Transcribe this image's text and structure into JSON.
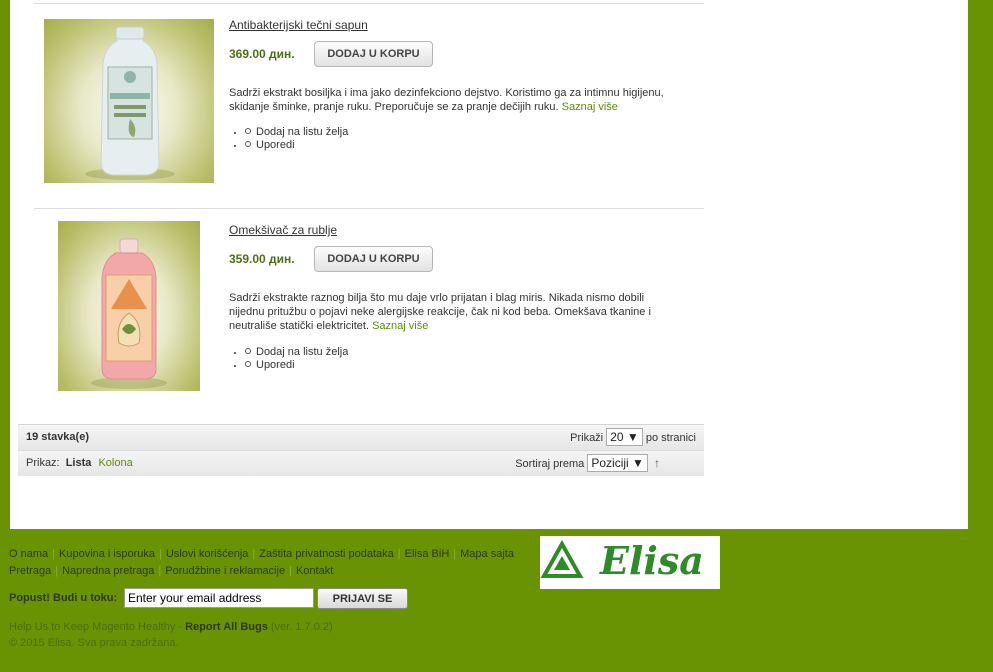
{
  "products": [
    {
      "name": "Antibakterijski tečni sapun",
      "price": "369.00 дин.",
      "cart_label": "DODAJ U KORPU",
      "description": "Sadrži ekstrakt bosiljka i ima jako dezinfekciono dejstvo. Koristimo ga za intimnu higijenu, skidanje šminke, pranje ruku. Preporučuje se za pranje dečijih ruku.",
      "more_label": "Saznaj više",
      "wishlist_label": "Dodaj na listu želja",
      "compare_label": "Uporedi"
    },
    {
      "name": "Omekšivač za rublje",
      "price": "359.00 дин.",
      "cart_label": "DODAJ U KORPU",
      "description": "Sadrži ekstrakte raznog bilja što mu daje vrlo prijatan i blag miris. Nikada nismo dobili nijednu pritužbu o pojavi neke alergijske reakcije, čak ni kod beba. Omekšava tkanine i neutrališe statički elektricitet.",
      "more_label": "Saznaj više",
      "wishlist_label": "Dodaj na listu želja",
      "compare_label": "Uporedi"
    }
  ],
  "toolbar": {
    "count": "19 stavka(e)",
    "show_label": "Prikaži",
    "limit": "20",
    "per_page_label": "po stranici",
    "view_label": "Prikaz:",
    "view_list": "Lista",
    "view_grid": "Kolona",
    "sort_label": "Sortiraj prema",
    "sort_value": "Poziciji",
    "sort_dir_icon": "↑"
  },
  "footer": {
    "links_row1": [
      "O nama",
      "Kupovina i isporuka",
      "Uslovi korišćenja",
      "Zaštita privatnosti podataka",
      "Elisa BiH",
      "Mapa sajta"
    ],
    "links_row2": [
      "Pretraga",
      "Napredna pretraga",
      "Porudžbine i reklamacije",
      "Kontakt"
    ],
    "newsletter_label": "Popust! Budi u toku:",
    "email_value": "Enter your email address",
    "subscribe_label": "PRIJAVI SE",
    "bug_prefix": "Help Us to Keep Magento Healthy -",
    "bug_link": "Report All Bugs",
    "version": "(ver. 1.7.0.2)",
    "copyright": "© 2015 Elisa. Sva prava zadržana.",
    "logo_text": "Elisa"
  },
  "colors": {
    "background": "#6a9304",
    "price": "#4d6f15",
    "link": "#5d8a0c",
    "logo": "#2f8a2a"
  }
}
